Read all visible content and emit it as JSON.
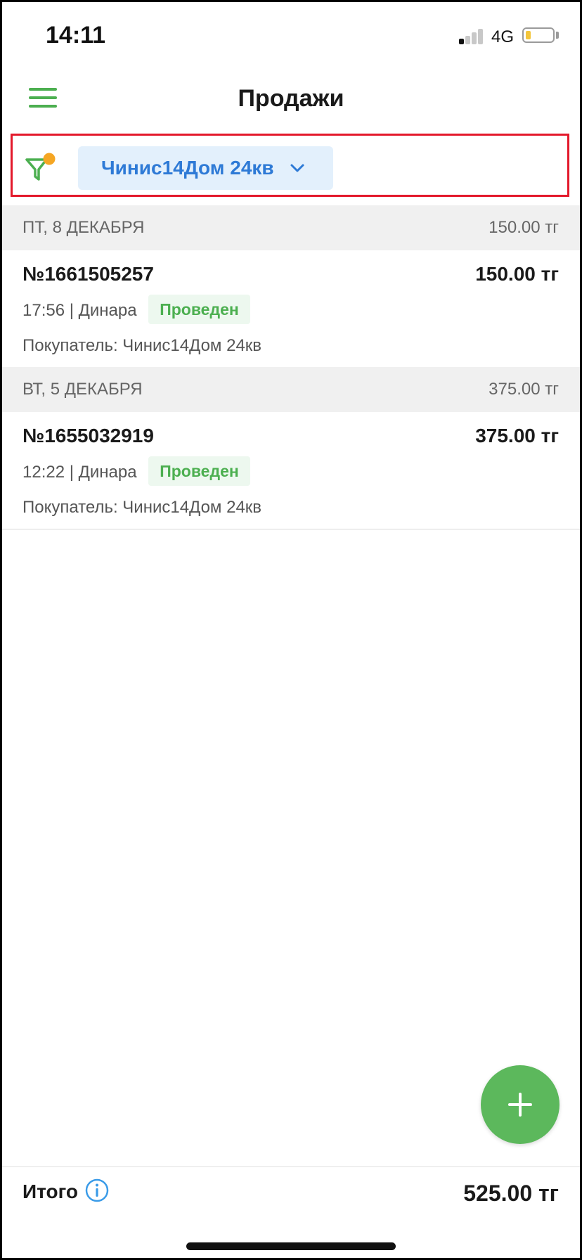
{
  "status_bar": {
    "time": "14:11",
    "network": "4G",
    "signal_bars_active": 1,
    "battery_level": 0.2,
    "battery_color": "#f3c53b"
  },
  "header": {
    "title": "Продажи",
    "menu_icon": "hamburger-menu-icon"
  },
  "filter": {
    "icon": "filter-funnel-icon",
    "active_dot_color": "#f5a623",
    "chip_label": "Чинис14Дом 24кв",
    "chip_icon": "chevron-down-icon",
    "highlight_color": "#e3192b"
  },
  "days": [
    {
      "date_label": "ПТ, 8 ДЕКАБРЯ",
      "day_total": "150.00 тг",
      "sales": [
        {
          "number": "№1661505257",
          "amount": "150.00 тг",
          "meta": "17:56 | Динара",
          "status": "Проведен",
          "buyer": "Покупатель: Чинис14Дом 24кв"
        }
      ]
    },
    {
      "date_label": "ВТ, 5 ДЕКАБРЯ",
      "day_total": "375.00 тг",
      "sales": [
        {
          "number": "№1655032919",
          "amount": "375.00 тг",
          "meta": "12:22 | Динара",
          "status": "Проведен",
          "buyer": "Покупатель: Чинис14Дом 24кв"
        }
      ]
    }
  ],
  "fab": {
    "icon": "plus-icon",
    "color": "#5cb85c"
  },
  "footer": {
    "total_label": "Итого",
    "info_icon": "info-icon",
    "total_value": "525.00 тг"
  },
  "colors": {
    "accent_green": "#4caf50",
    "accent_blue": "#2e7ad6"
  }
}
